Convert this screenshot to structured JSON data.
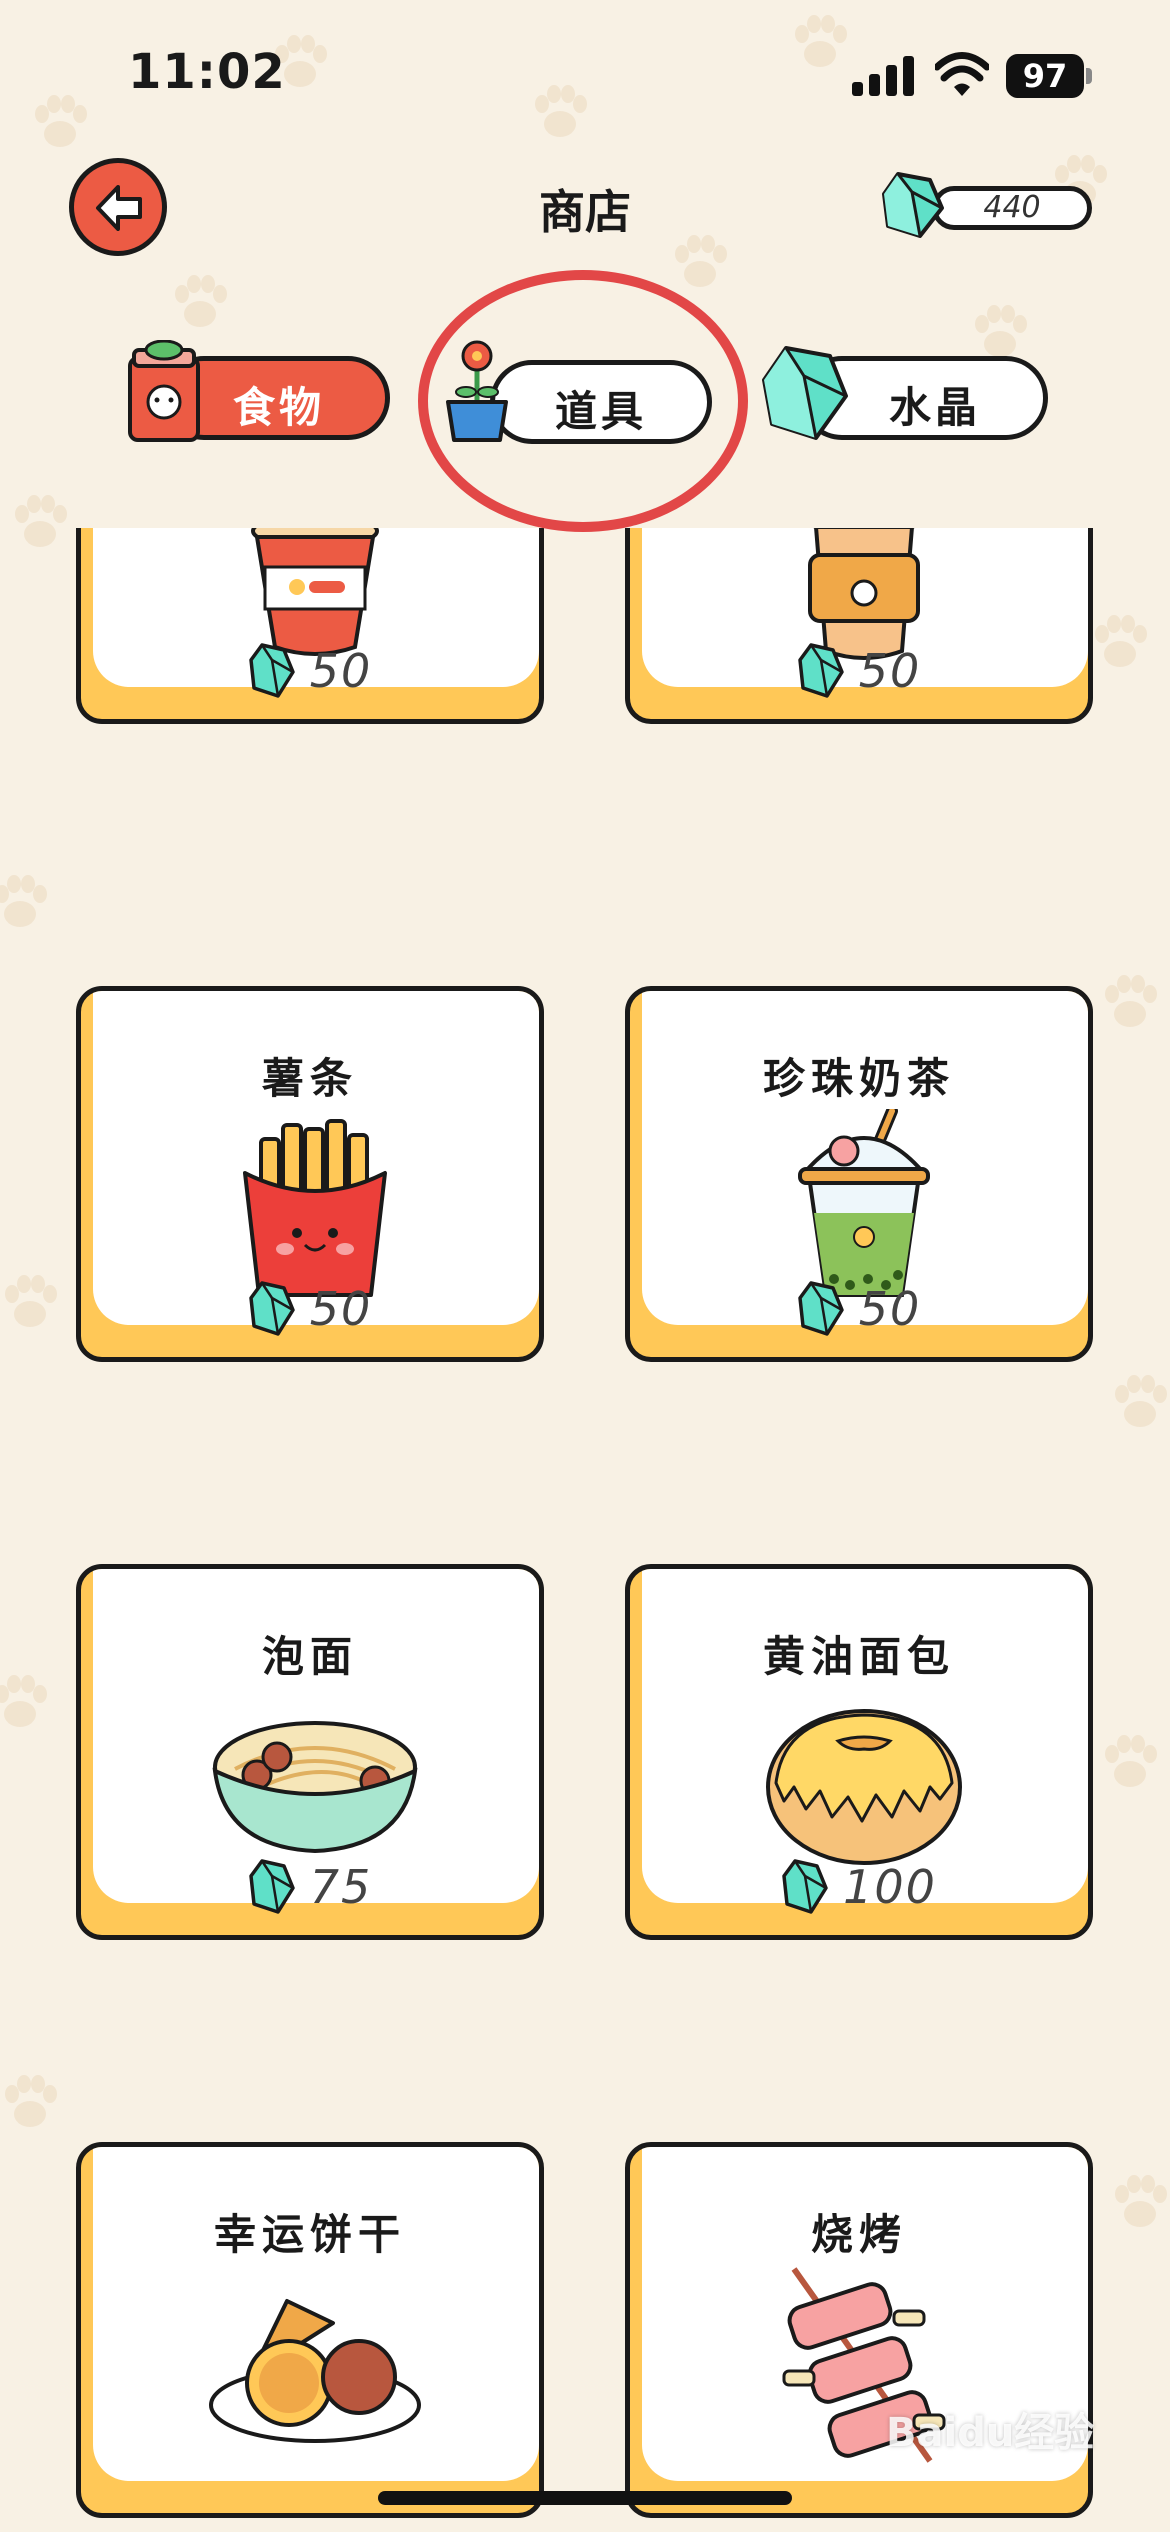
{
  "status_bar": {
    "time": "11:02",
    "battery": "97"
  },
  "header": {
    "title": "商店",
    "crystal_balance": "440"
  },
  "tabs": [
    {
      "label": "食物",
      "icon": "cat-food-bag-icon",
      "active": true
    },
    {
      "label": "道具",
      "icon": "flower-pot-icon",
      "active": false,
      "highlighted": true
    },
    {
      "label": "水晶",
      "icon": "crystal-icon",
      "active": false
    }
  ],
  "items": [
    {
      "name": "",
      "icon": "cola-cup-icon",
      "price": "50"
    },
    {
      "name": "",
      "icon": "coffee-cup-icon",
      "price": "50"
    },
    {
      "name": "薯条",
      "icon": "french-fries-icon",
      "price": "50"
    },
    {
      "name": "珍珠奶茶",
      "icon": "bubble-tea-icon",
      "price": "50"
    },
    {
      "name": "泡面",
      "icon": "instant-noodles-icon",
      "price": "75"
    },
    {
      "name": "黄油面包",
      "icon": "butter-bread-icon",
      "price": "100"
    },
    {
      "name": "幸运饼干",
      "icon": "fortune-cookie-icon",
      "price": ""
    },
    {
      "name": "烧烤",
      "icon": "bbq-skewer-icon",
      "price": ""
    }
  ],
  "colors": {
    "accent": "#ec5b44",
    "card_border": "#ffc857",
    "background": "#f8f1e4",
    "crystal": "#5fe0c8",
    "highlight": "#e24747"
  },
  "watermark": "Baidu经验"
}
